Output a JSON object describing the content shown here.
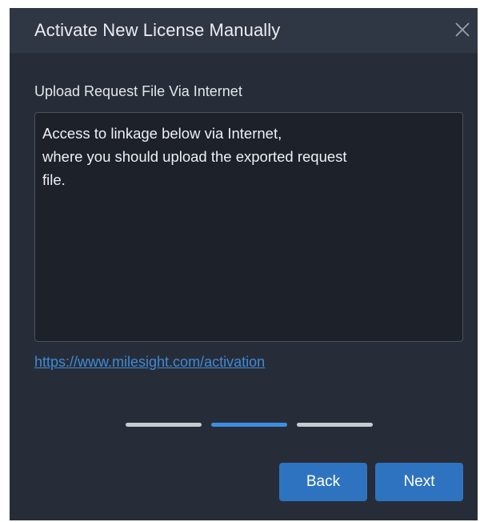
{
  "dialog": {
    "title": "Activate New License Manually",
    "close_icon": "close-icon",
    "section_label": "Upload Request File Via Internet",
    "instructions": {
      "line1": "Access to linkage below via Internet,",
      "line2": "where you should upload the exported request",
      "line3": "file."
    },
    "link": "https://www.milesight.com/activation",
    "steps": {
      "total": 3,
      "current": 2
    },
    "buttons": {
      "back": "Back",
      "next": "Next"
    }
  },
  "colors": {
    "dialog_bg": "#272d38",
    "titlebar_bg": "#303744",
    "textbox_bg": "#1c212a",
    "accent": "#2e73bf",
    "link": "#3e8ad8",
    "step_active": "#3d8fe3",
    "step_inactive": "#c7cbd1"
  }
}
